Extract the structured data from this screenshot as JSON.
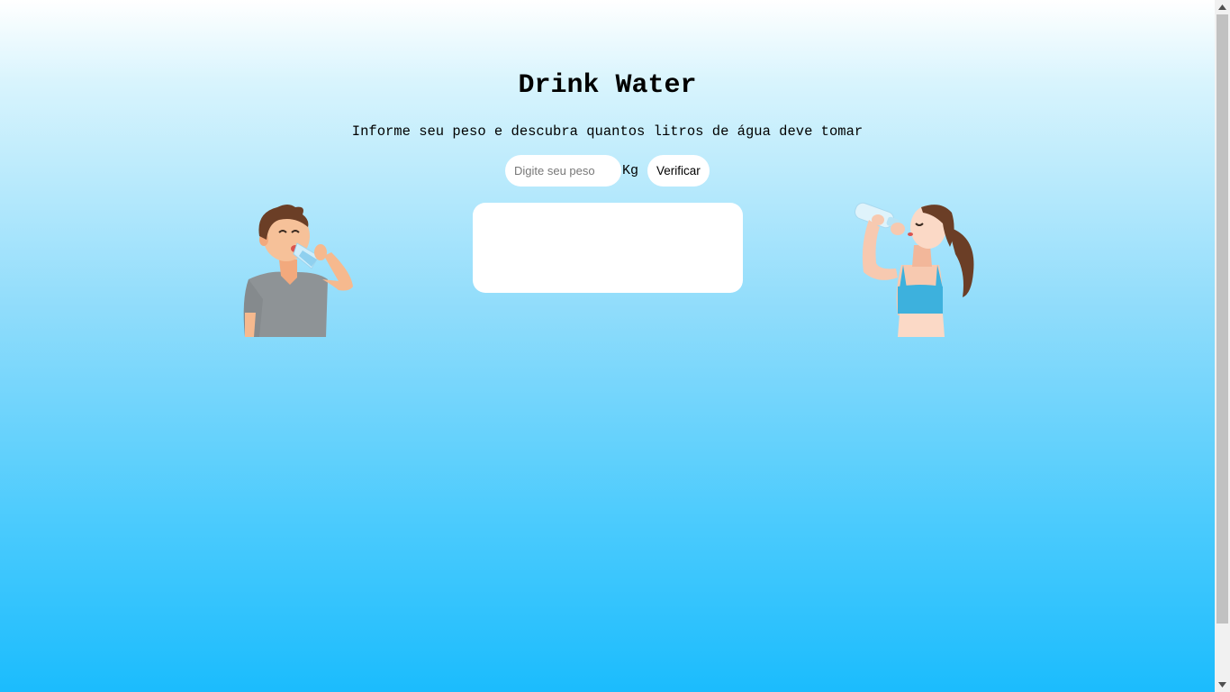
{
  "header": {
    "title": "Drink Water",
    "subtitle": "Informe seu peso e descubra quantos litros de água deve tomar"
  },
  "form": {
    "weight_placeholder": "Digite seu peso",
    "weight_value": "",
    "unit": "Kg",
    "verify_label": "Verificar"
  },
  "result": {
    "text": ""
  },
  "illustrations": {
    "left": "man-drinking-water-icon",
    "right": "woman-drinking-water-icon"
  },
  "colors": {
    "background_top": "#ffffff",
    "background_bottom": "#1bbcfd",
    "shirt": "#8e9396",
    "top": "#3db1dd",
    "hair": "#6b3e26"
  }
}
